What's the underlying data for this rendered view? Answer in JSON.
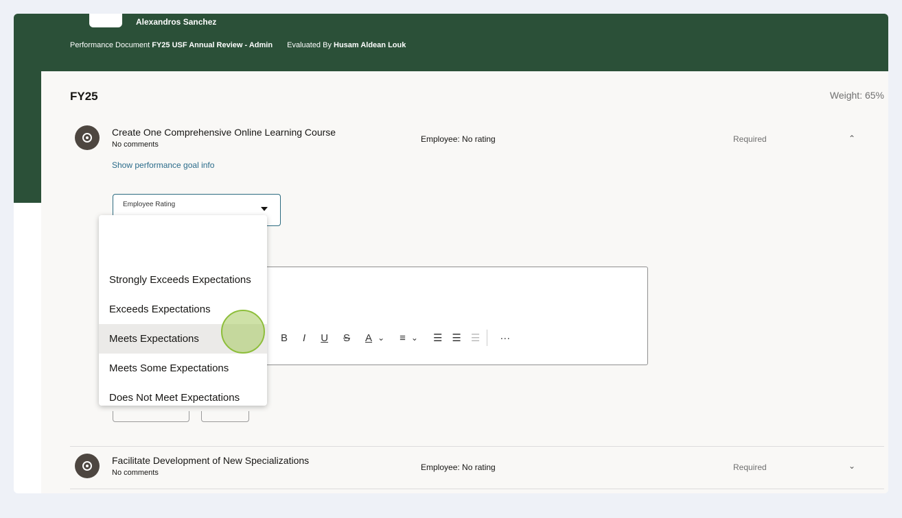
{
  "header": {
    "employee_name": "Alexandros Sanchez",
    "doc_label": "Performance Document",
    "doc_value": "FY25 USF Annual Review - Admin",
    "evaluated_label": "Evaluated By",
    "evaluated_value": "Husam Aldean Louk"
  },
  "section": {
    "title": "FY25",
    "weight": "Weight: 65%"
  },
  "goals": [
    {
      "title": "Create One Comprehensive Online Learning Course",
      "comments": "No comments",
      "rating": "Employee: No rating",
      "required": "Required",
      "link": "Show performance goal info",
      "icon": "target-icon",
      "expanded": true
    },
    {
      "title": "Facilitate Development of New Specializations",
      "comments": "No comments",
      "rating": "Employee: No rating",
      "required": "Required",
      "icon": "target-icon",
      "expanded": false
    }
  ],
  "rating_select": {
    "label": "Employee Rating",
    "options": [
      "Strongly Exceeds Expectations",
      "Exceeds Expectations",
      "Meets Expectations",
      "Meets Some Expectations",
      "Does Not Meet Expectations"
    ],
    "highlighted": "Meets Expectations"
  },
  "editor_toolbar": {
    "bold": "B",
    "italic": "I",
    "underline": "U",
    "strike": "S",
    "font_color": "A",
    "more": "···"
  },
  "colors": {
    "header_green": "#2b5038",
    "link_blue": "#2a6b8a",
    "focus_border": "#2b6a7f",
    "cursor_green": "#8dbe3a"
  }
}
